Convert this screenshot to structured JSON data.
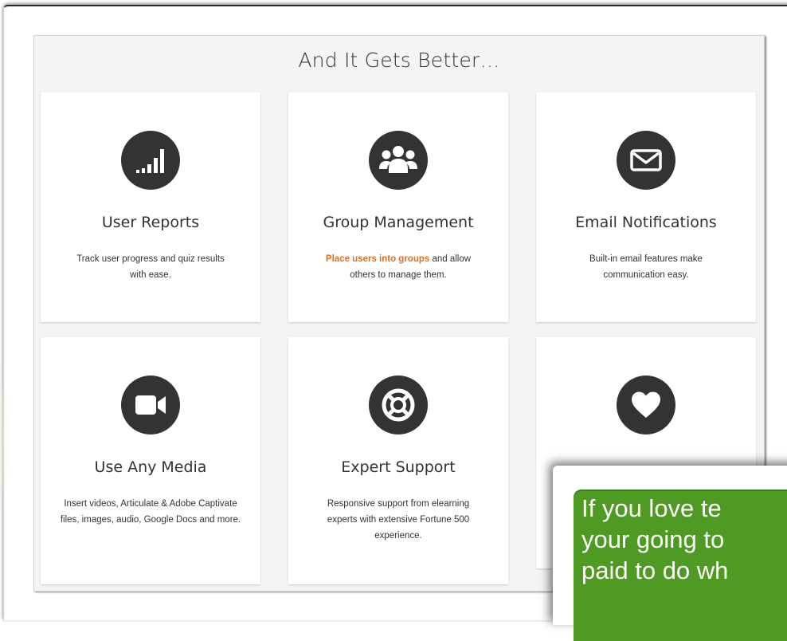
{
  "panel": {
    "title": "And It Gets Better…"
  },
  "cards": [
    {
      "icon": "signal-bars-icon",
      "title": "User Reports",
      "desc": "Track user progress and quiz results with ease."
    },
    {
      "icon": "users-group-icon",
      "title": "Group Management",
      "desc_highlight": "Place users into groups",
      "desc_rest": " and allow others to manage them."
    },
    {
      "icon": "envelope-icon",
      "title": "Email Notifications",
      "desc": "Built-in email features make communication easy."
    },
    {
      "icon": "video-camera-icon",
      "title": "Use Any Media",
      "desc": "Insert videos, Articulate & Adobe Captivate files, images, audio, Google Docs and more."
    },
    {
      "icon": "life-ring-icon",
      "title": "Expert Support",
      "desc": "Responsive support from elearning experts with extensive Fortune 500 experience."
    },
    {
      "icon": "heart-icon",
      "title": "",
      "desc": ""
    }
  ],
  "popup": {
    "lines": [
      "If you love te",
      "your going to",
      "paid to do wh"
    ]
  },
  "colors": {
    "icon_bg": "#333333",
    "highlight": "#e0701f",
    "popup_green": "#4e9a22",
    "panel_bg": "#f4f4f4"
  }
}
